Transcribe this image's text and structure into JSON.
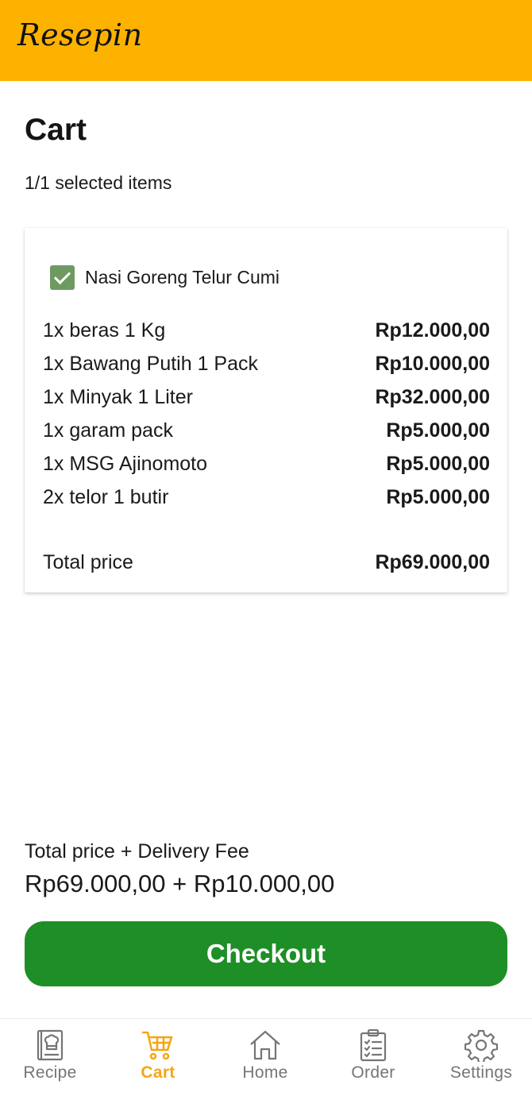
{
  "app": {
    "brand": "Resepin"
  },
  "colors": {
    "appbar": "#FDB200",
    "accent": "#F3A716",
    "checkout": "#1E8E26",
    "checkbox": "#6E9A62",
    "nav_inactive": "#757575"
  },
  "cart": {
    "title": "Cart",
    "selected_text": "1/1 selected items",
    "recipe": {
      "name": "Nasi Goreng Telur Cumi",
      "checked": true,
      "items": [
        {
          "name": "1x beras 1 Kg",
          "price": "Rp12.000,00"
        },
        {
          "name": "1x Bawang Putih 1 Pack",
          "price": "Rp10.000,00"
        },
        {
          "name": "1x Minyak 1 Liter",
          "price": "Rp32.000,00"
        },
        {
          "name": "1x garam pack",
          "price": "Rp5.000,00"
        },
        {
          "name": "1x MSG Ajinomoto",
          "price": "Rp5.000,00"
        },
        {
          "name": "2x telor 1 butir",
          "price": "Rp5.000,00"
        }
      ],
      "total_label": "Total price",
      "total_value": "Rp69.000,00"
    },
    "delivery_label": "Total price + Delivery Fee",
    "delivery_value": "Rp69.000,00 + Rp10.000,00",
    "checkout_label": "Checkout"
  },
  "nav": {
    "items": [
      {
        "label": "Recipe",
        "icon": "recipe-book-icon",
        "active": false
      },
      {
        "label": "Cart",
        "icon": "cart-icon",
        "active": true
      },
      {
        "label": "Home",
        "icon": "home-icon",
        "active": false
      },
      {
        "label": "Order",
        "icon": "order-clipboard-icon",
        "active": false
      },
      {
        "label": "Settings",
        "icon": "gear-icon",
        "active": false
      }
    ]
  }
}
